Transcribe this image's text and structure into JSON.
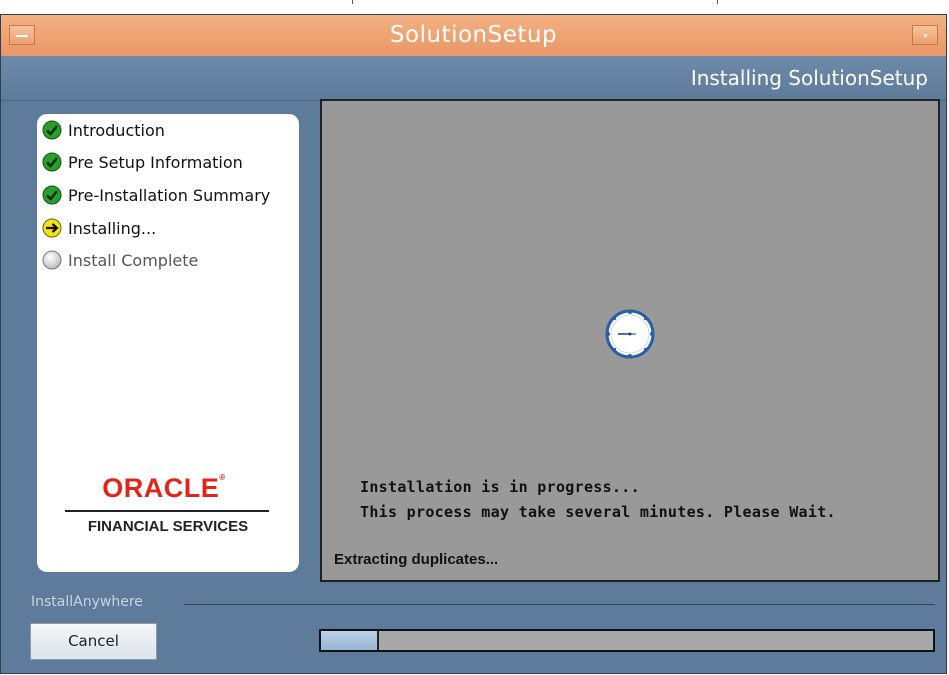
{
  "window": {
    "title": "SolutionSetup",
    "header": "Installing SolutionSetup"
  },
  "steps": [
    {
      "label": "Introduction",
      "state": "complete",
      "icon": "check-icon"
    },
    {
      "label": "Pre Setup Information",
      "state": "complete",
      "icon": "check-icon"
    },
    {
      "label": "Pre-Installation Summary",
      "state": "complete",
      "icon": "check-icon"
    },
    {
      "label": "Installing...",
      "state": "current",
      "icon": "arrow-right-icon"
    },
    {
      "label": "Install Complete",
      "state": "pending",
      "icon": "circle-icon"
    }
  ],
  "branding": {
    "logo_text": "ORACLE",
    "subtitle": "FINANCIAL SERVICES"
  },
  "content": {
    "message_line1": "Installation is in progress...",
    "message_line2": "This process may take several minutes. Please Wait.",
    "status": "Extracting duplicates..."
  },
  "footer": {
    "group_label": "InstallAnywhere",
    "cancel_label": "Cancel"
  },
  "progress": {
    "fraction": 0.095
  },
  "colors": {
    "titlebar": "#e89766",
    "window_bg": "#5f7b9c",
    "content_bg": "#999999",
    "complete": "#2aa02a",
    "current": "#f2e21a",
    "oracle_red": "#e1251b"
  }
}
